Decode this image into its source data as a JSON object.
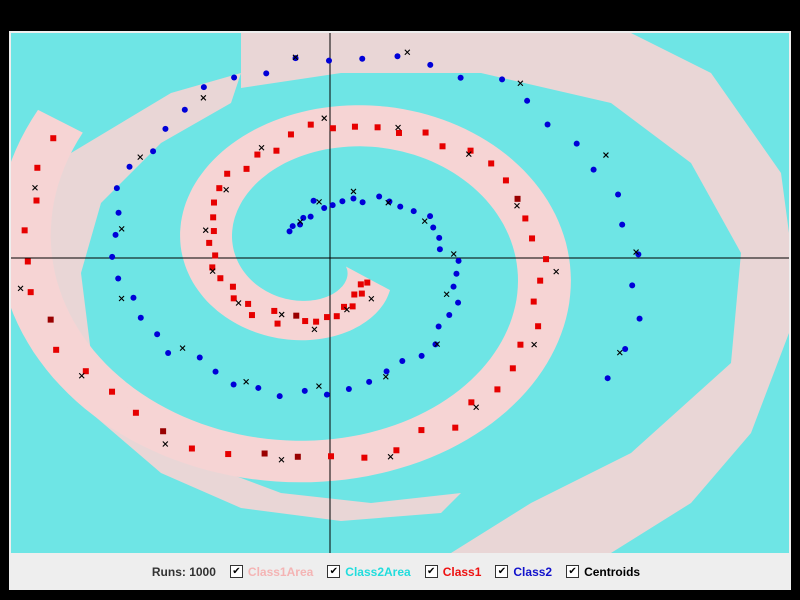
{
  "colors": {
    "class1_area": "#f4c8c8",
    "class2_area": "#45dede",
    "class1_point": "#e60000",
    "class2_point": "#0000d8",
    "centroid": "#000000",
    "axis": "#000000"
  },
  "legend": {
    "runs_label": "Runs: 1000",
    "items": [
      {
        "label": "Class1Area",
        "checked": true,
        "color": "#f4b4b4"
      },
      {
        "label": "Class2Area",
        "checked": true,
        "color": "#22dddd"
      },
      {
        "label": "Class1",
        "checked": true,
        "color": "#ee1111"
      },
      {
        "label": "Class2",
        "checked": true,
        "color": "#1111cc"
      },
      {
        "label": "Centroids",
        "checked": true,
        "color": "#000000"
      }
    ],
    "check_glyph": "✔"
  },
  "chart_data": {
    "type": "scatter",
    "title": "",
    "xlabel": "",
    "ylabel": "",
    "grid": false,
    "description_pattern": "two interleaved spirals classified by nearest-centroid regions",
    "series": [
      {
        "name": "Class1",
        "marker": "square"
      },
      {
        "name": "Class2",
        "marker": "circle"
      },
      {
        "name": "Centroids",
        "marker": "x"
      }
    ]
  }
}
